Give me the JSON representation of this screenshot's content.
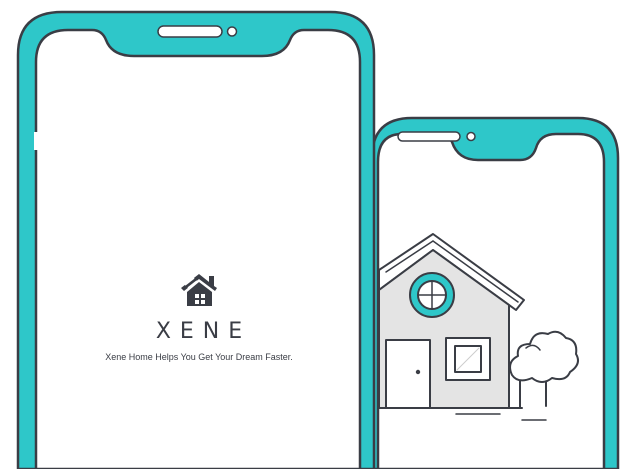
{
  "splash": {
    "brand": "XENE",
    "tagline": "Xene Home Helps You Get Your Dream Faster.",
    "logo_icon": "house-logo-icon"
  },
  "illustration": {
    "icon": "house-illustration-icon"
  },
  "colors": {
    "accent": "#2ec7c9",
    "outline": "#3a3d45",
    "screen": "#ffffff",
    "house_fill": "#e4e4e4",
    "window_glass": "#ffffff"
  }
}
